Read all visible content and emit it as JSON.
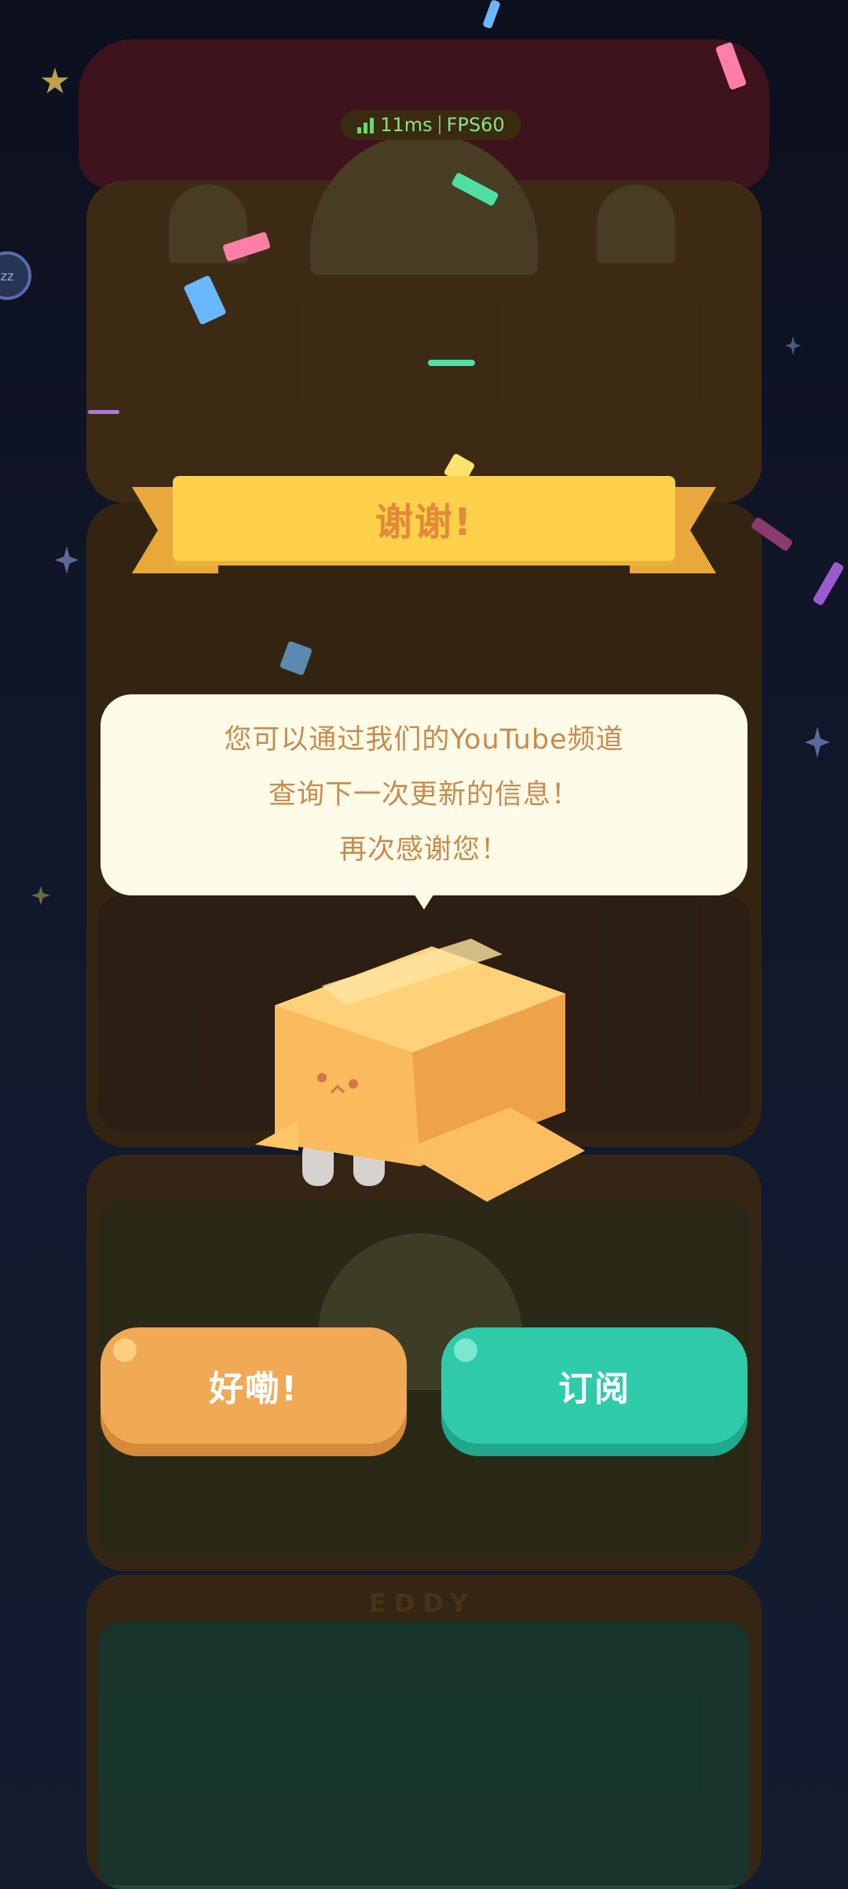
{
  "hud": {
    "ping": "11ms",
    "fps": "FPS60",
    "signal_icon": "signal-bars-icon"
  },
  "banner": {
    "title": "谢谢!"
  },
  "dialog": {
    "lines": [
      "您可以通过我们的YouTube频道",
      "查询下一次更新的信息！",
      "再次感谢您！"
    ]
  },
  "buttons": {
    "ok": "好嘞!",
    "subscribe": "订阅"
  },
  "tower": {
    "nameplate": "EDDY"
  },
  "side_badge": {
    "label": "zz"
  },
  "colors": {
    "banner": "#ffd04a",
    "banner_text": "#e3893b",
    "dialog_bg": "#fefbe8",
    "dialog_text": "#c98a4e",
    "ok_button": "#f0a955",
    "subscribe_button": "#2fcba8",
    "hud_text": "#8fe08a"
  }
}
